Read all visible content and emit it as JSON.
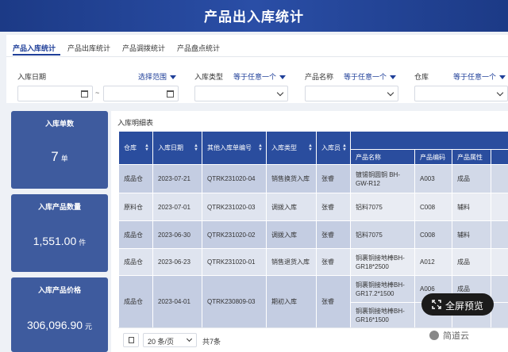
{
  "header": {
    "title": "产品出入库统计"
  },
  "tabs": [
    {
      "label": "产品入库统计",
      "active": true
    },
    {
      "label": "产品出库统计",
      "active": false
    },
    {
      "label": "产品调拨统计",
      "active": false
    },
    {
      "label": "产品盘点统计",
      "active": false
    }
  ],
  "filters": {
    "date_label": "入库日期",
    "date_range_label": "选择范围",
    "date_separator": "~",
    "type_label": "入库类型",
    "type_mode": "等于任意一个",
    "product_label": "产品名称",
    "product_mode": "等于任意一个",
    "warehouse_label": "仓库",
    "warehouse_mode": "等于任意一个"
  },
  "stats": {
    "count": {
      "label": "入库单数",
      "value": "7",
      "unit": "单"
    },
    "quantity": {
      "label": "入库产品数量",
      "value": "1,551.00",
      "unit": "件"
    },
    "price": {
      "label": "入库产品价格",
      "value": "306,096.90",
      "unit": "元"
    }
  },
  "detail": {
    "title": "入库明细表",
    "columns": {
      "warehouse": "仓库",
      "date": "入库日期",
      "order_no": "其他入库单编号",
      "type": "入库类型",
      "staff": "入库员",
      "product_name": "产品名称",
      "product_code": "产品编码",
      "product_attr": "产品属性"
    },
    "rows": [
      {
        "warehouse": "成品仓",
        "date": "2023-07-21",
        "order_no": "QTRK231020-04",
        "type": "销售换货入库",
        "staff": "张睿",
        "items": [
          {
            "name": "镀锡铜圆铜 BH-GW-R12",
            "code": "A003",
            "attr": "成品"
          }
        ]
      },
      {
        "warehouse": "原料仓",
        "date": "2023-07-01",
        "order_no": "QTRK231020-03",
        "type": "调拨入库",
        "staff": "张睿",
        "items": [
          {
            "name": "铝料7075",
            "code": "C008",
            "attr": "辅料"
          }
        ]
      },
      {
        "warehouse": "成品仓",
        "date": "2023-06-30",
        "order_no": "QTRK231020-02",
        "type": "调拨入库",
        "staff": "张睿",
        "items": [
          {
            "name": "铝料7075",
            "code": "C008",
            "attr": "辅料"
          }
        ]
      },
      {
        "warehouse": "成品仓",
        "date": "2023-06-23",
        "order_no": "QTRK231020-01",
        "type": "销售退货入库",
        "staff": "张睿",
        "items": [
          {
            "name": "铜裹铜接地棒BH-GR18*2500",
            "code": "A012",
            "attr": "成品"
          }
        ]
      },
      {
        "warehouse": "成品仓",
        "date": "2023-04-01",
        "order_no": "QTRK230809-03",
        "type": "期初入库",
        "staff": "张睿",
        "items": [
          {
            "name": "铜裹铜接地棒BH-GR17.2*1500",
            "code": "A006",
            "attr": "成品"
          },
          {
            "name": "铜裹铜接地棒BH-GR16*1500",
            "code": "",
            "attr": ""
          }
        ]
      }
    ]
  },
  "pagination": {
    "page_size": "20 条/页",
    "total": "共7条"
  },
  "fullscreen": {
    "label": "全屏预览"
  },
  "watermark": {
    "text": "简道云"
  }
}
